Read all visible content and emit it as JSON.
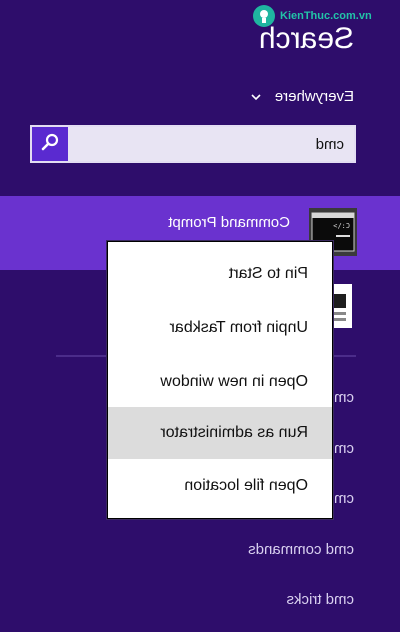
{
  "watermark": "KienThuc.com.vn",
  "header": {
    "title": "Search"
  },
  "scope": {
    "label": "Everywhere"
  },
  "search": {
    "value": "cmd"
  },
  "results": [
    {
      "label": "Command Prompt",
      "selected": true
    },
    {
      "label": "cmd"
    }
  ],
  "context_menu": {
    "items": [
      {
        "label": "Pin to Start"
      },
      {
        "label": "Unpin from Taskbar"
      },
      {
        "label": "Open in new window"
      },
      {
        "label": "Run as administrator",
        "highlighted": true
      },
      {
        "label": "Open file location"
      }
    ]
  },
  "suggestions": [
    {
      "label": "cmd"
    },
    {
      "label": "cmd"
    },
    {
      "label": "cmd"
    },
    {
      "label": "cmd commands"
    },
    {
      "label": "cmd tricks"
    }
  ],
  "colors": {
    "background": "#2e0d6b",
    "selection": "#6a32cf",
    "search_button": "#5a2ad0",
    "menu_highlight": "#dcdcdc"
  }
}
